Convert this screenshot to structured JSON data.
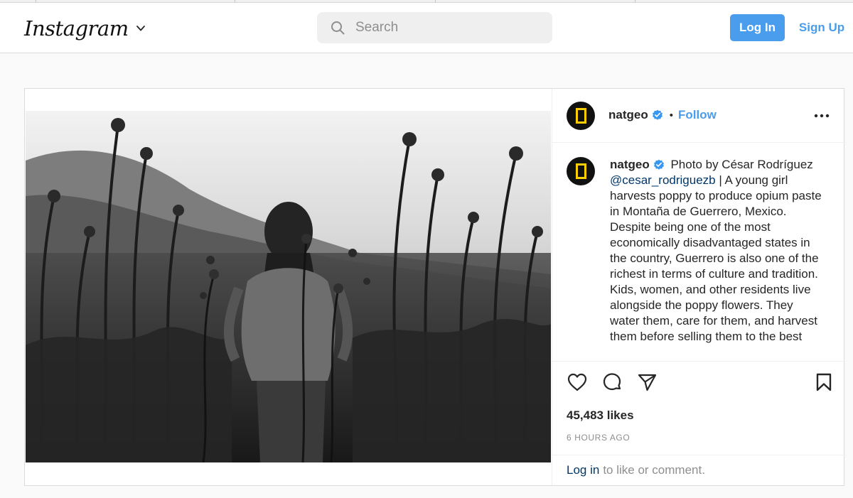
{
  "app": {
    "logo_text": "Instagram",
    "accent_color": "#4a9cec"
  },
  "header": {
    "search_placeholder": "Search",
    "login_label": "Log In",
    "signup_label": "Sign Up"
  },
  "post": {
    "username": "natgeo",
    "verified": true,
    "follow_label": "Follow",
    "separator": "•",
    "caption": {
      "username": "natgeo",
      "lead": "Photo by César Rodríguez",
      "mention": "@cesar_rodriguezb",
      "body": " | A young girl harvests poppy to produce opium paste in Montaña de Guerrero, Mexico. Despite being one of the most economically disadvantaged states in the country, Guerrero is also one of the richest in terms of culture and tradition. Kids, women, and other residents live alongside the poppy flowers. They water them, care for them, and harvest them before selling them to the best"
    },
    "likes": "45,483 likes",
    "time_ago": "6 HOURS AGO",
    "login_link": "Log in",
    "login_suffix": "to like or comment.",
    "icons": [
      "heart-icon",
      "comment-icon",
      "share-icon",
      "bookmark-icon",
      "more-options-icon",
      "verified-badge-icon",
      "search-icon",
      "chevron-down-icon"
    ]
  }
}
